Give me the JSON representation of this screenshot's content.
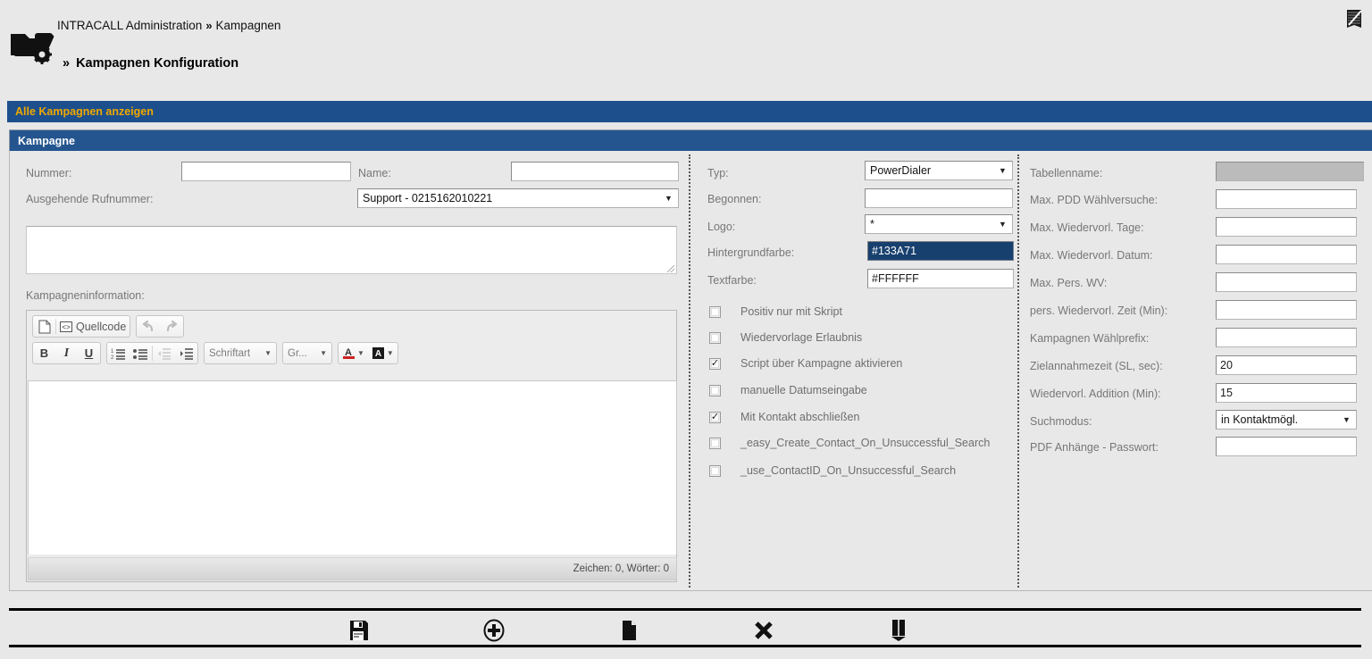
{
  "header": {
    "breadcrumb_root": "INTRACALL Administration",
    "breadcrumb_sep": "»",
    "breadcrumb_current": "Kampagnen",
    "title_chevron": "»",
    "title": "Kampagnen Konfiguration",
    "logo_icon": "folder-gear-icon",
    "top_right_icon": "notepad-pen-icon"
  },
  "bars": {
    "show_all": "Alle Kampagnen anzeigen",
    "section": "Kampagne",
    "blue_bar_color": "#1d4f8c",
    "accent_color": "#f0a800"
  },
  "left_column": {
    "nummer_label": "Nummer:",
    "nummer_value": "",
    "name_label": "Name:",
    "name_value": "",
    "outgoing_label": "Ausgehende Rufnummer:",
    "outgoing_value": "Support - 0215162010221",
    "description_value": "",
    "info_label": "Kampagneninformation:"
  },
  "editor": {
    "new_page_title": "new-document-icon",
    "source_label": "Quellcode",
    "source_icon": "source-code-icon",
    "undo_icon": "undo-arrow-icon",
    "redo_icon": "redo-arrow-icon",
    "bold_label": "B",
    "italic_label": "I",
    "underline_label": "U",
    "numbered_list_icon": "numbered-list-icon",
    "bullet_list_icon": "bullet-list-icon",
    "outdent_icon": "outdent-icon",
    "indent_icon": "indent-icon",
    "font_label": "Schriftart",
    "size_label": "Gr...",
    "text_color_icon": "text-color-icon",
    "bg_color_icon": "background-color-icon",
    "content": "",
    "status": "Zeichen: 0, Wörter: 0"
  },
  "middle_column": {
    "fields": [
      {
        "label": "Typ:",
        "value": "PowerDialer",
        "kind": "select"
      },
      {
        "label": "Begonnen:",
        "value": "",
        "kind": "input"
      },
      {
        "label": "Logo:",
        "value": "*",
        "kind": "select"
      },
      {
        "label": "Hintergrundfarbe:",
        "value": "#133A71",
        "kind": "input-highlighted"
      },
      {
        "label": "Textfarbe:",
        "value": "#FFFFFF",
        "kind": "input"
      }
    ],
    "checkboxes": [
      {
        "label": "Positiv nur mit Skript",
        "checked": false
      },
      {
        "label": "Wiedervorlage Erlaubnis",
        "checked": false
      },
      {
        "label": "Script über Kampagne aktivieren",
        "checked": true
      },
      {
        "label": "manuelle Datumseingabe",
        "checked": false
      },
      {
        "label": "Mit Kontakt abschließen",
        "checked": true
      },
      {
        "label": "_easy_Create_Contact_On_Unsuccessful_Search",
        "checked": false
      },
      {
        "label": "_use_ContactID_On_Unsuccessful_Search",
        "checked": false
      }
    ]
  },
  "right_column": {
    "fields": [
      {
        "label": "Tabellenname:",
        "value": "",
        "kind": "input-disabled"
      },
      {
        "label": "Max. PDD Wählversuche:",
        "value": "",
        "kind": "input"
      },
      {
        "label": "Max. Wiedervorl. Tage:",
        "value": "",
        "kind": "input"
      },
      {
        "label": "Max. Wiedervorl. Datum:",
        "value": "",
        "kind": "input"
      },
      {
        "label": "Max. Pers. WV:",
        "value": "",
        "kind": "input"
      },
      {
        "label": "pers. Wiedervorl. Zeit (Min):",
        "value": "",
        "kind": "input"
      },
      {
        "label": "Kampagnen Wählprefix:",
        "value": "",
        "kind": "input"
      },
      {
        "label": "Zielannahmezeit (SL, sec):",
        "value": "20",
        "kind": "input"
      },
      {
        "label": "Wiedervorl. Addition (Min):",
        "value": "15",
        "kind": "input"
      },
      {
        "label": "Suchmodus:",
        "value": "in Kontaktmögl.",
        "kind": "select"
      },
      {
        "label": "PDF Anhänge - Passwort:",
        "value": "",
        "kind": "input"
      }
    ]
  },
  "bottom_toolbar": {
    "buttons": [
      {
        "name": "save-button",
        "icon": "floppy-disk-icon"
      },
      {
        "name": "add-button",
        "icon": "plus-circle-icon"
      },
      {
        "name": "new-document-button",
        "icon": "document-icon"
      },
      {
        "name": "delete-button",
        "icon": "x-cross-icon"
      },
      {
        "name": "export-button",
        "icon": "book-export-icon"
      }
    ]
  }
}
